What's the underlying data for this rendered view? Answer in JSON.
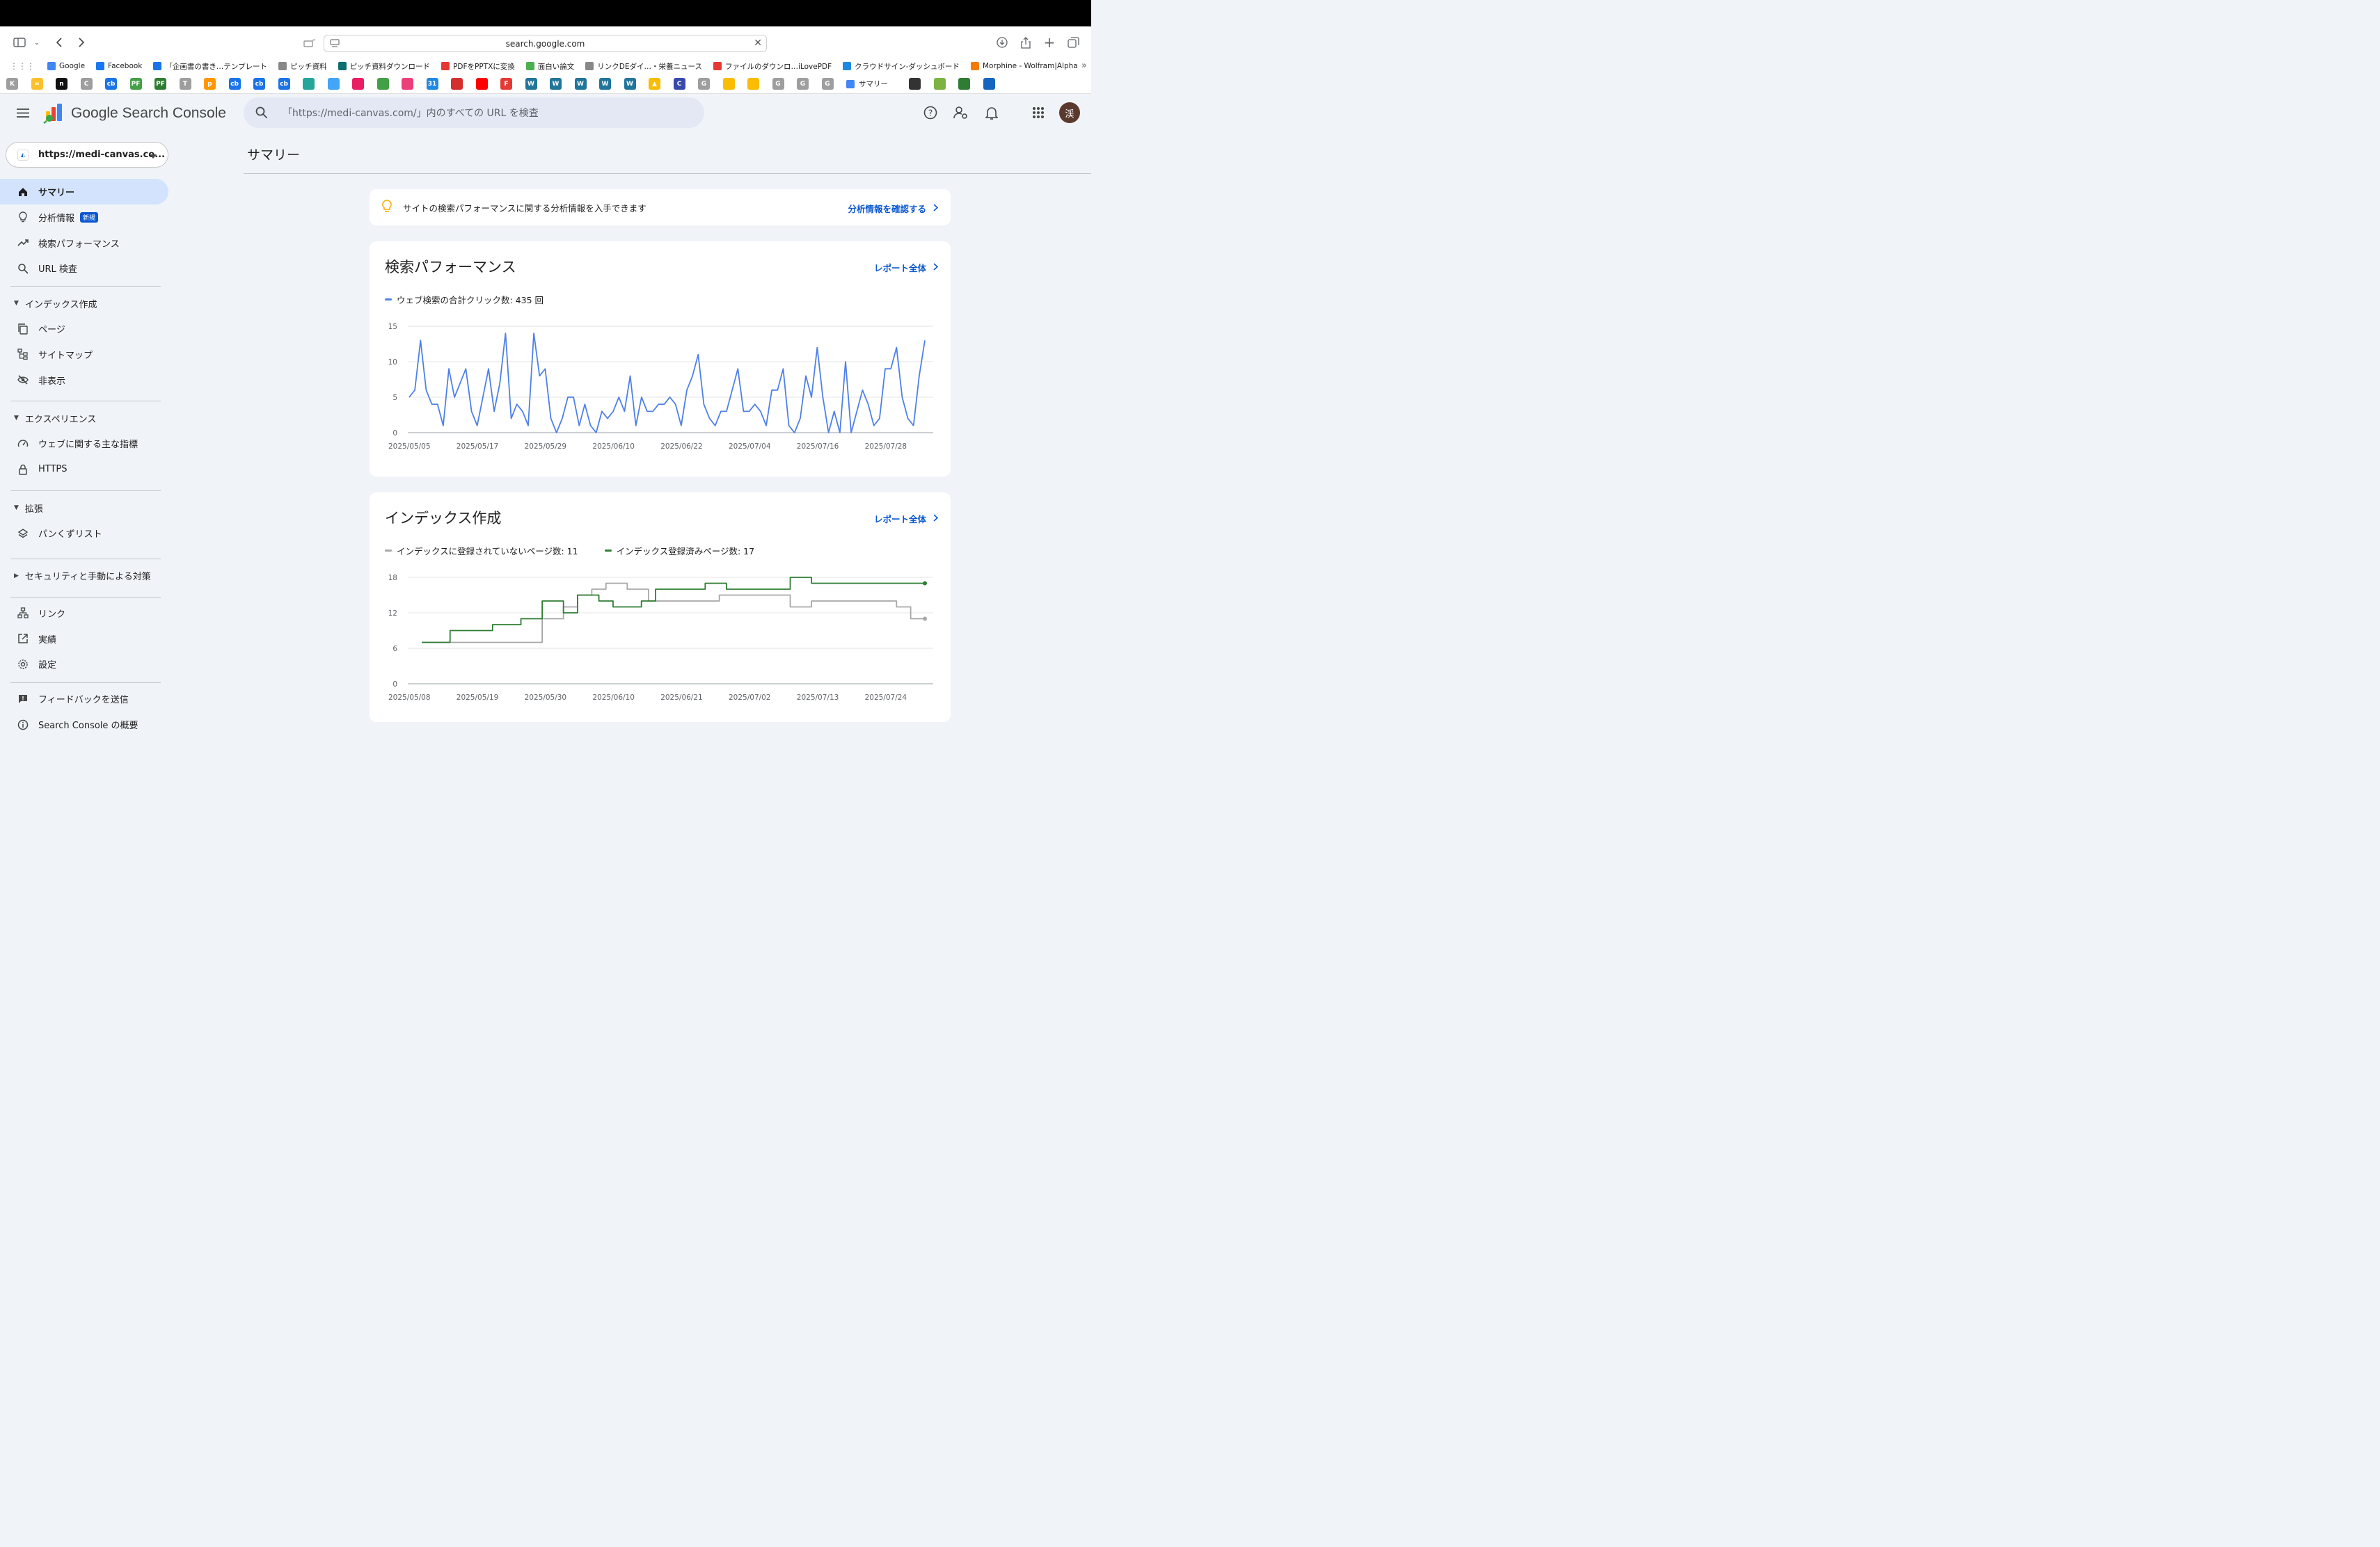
{
  "browser": {
    "url": "search.google.com",
    "bookmarks": [
      {
        "label": "Google",
        "color": "#4285f4"
      },
      {
        "label": "Facebook",
        "color": "#1877f2"
      },
      {
        "label": "「企画書の書き…テンプレート",
        "color": "#1a73e8"
      },
      {
        "label": "ピッチ資料",
        "color": "#888888"
      },
      {
        "label": "ピッチ資料ダウンロード",
        "color": "#0f6e6e"
      },
      {
        "label": "PDFをPPTXに変換",
        "color": "#e53935"
      },
      {
        "label": "面白い論文",
        "color": "#4caf50"
      },
      {
        "label": "リンクDEダイ…・栄養ニュース",
        "color": "#888888"
      },
      {
        "label": "ファイルのダウンロ…iLovePDF",
        "color": "#e53935"
      },
      {
        "label": "クラウドサイン-ダッシュボード",
        "color": "#1e88e5"
      },
      {
        "label": "Morphine - Wolfram|Alpha",
        "color": "#f57c00"
      }
    ],
    "favicons": [
      {
        "text": "K",
        "color": "#9e9e9e"
      },
      {
        "text": "∞",
        "color": "#fbc02d"
      },
      {
        "text": "n",
        "color": "#111111"
      },
      {
        "text": "C",
        "color": "#9e9e9e"
      },
      {
        "text": "cb",
        "color": "#1a73e8"
      },
      {
        "text": "PF",
        "color": "#43a047"
      },
      {
        "text": "PF",
        "color": "#2e7d32"
      },
      {
        "text": "T",
        "color": "#9e9e9e"
      },
      {
        "text": "p",
        "color": "#ff9800"
      },
      {
        "text": "cb",
        "color": "#1a73e8"
      },
      {
        "text": "cb",
        "color": "#1a73e8"
      },
      {
        "text": "cb",
        "color": "#1a73e8"
      },
      {
        "text": "",
        "color": "#26a69a"
      },
      {
        "text": "",
        "color": "#42a5f5"
      },
      {
        "text": "",
        "color": "#e91e63"
      },
      {
        "text": "",
        "color": "#43a047"
      },
      {
        "text": "",
        "color": "#ec407a"
      },
      {
        "text": "31",
        "color": "#1e88e5"
      },
      {
        "text": "",
        "color": "#d32f2f"
      },
      {
        "text": "",
        "color": "#ff0000"
      },
      {
        "text": "F",
        "color": "#e53935"
      },
      {
        "text": "W",
        "color": "#21759b"
      },
      {
        "text": "W",
        "color": "#21759b"
      },
      {
        "text": "W",
        "color": "#21759b"
      },
      {
        "text": "W",
        "color": "#21759b"
      },
      {
        "text": "W",
        "color": "#21759b"
      },
      {
        "text": "▲",
        "color": "#fbbc04"
      },
      {
        "text": "C",
        "color": "#3949ab"
      },
      {
        "text": "G",
        "color": "#9e9e9e"
      },
      {
        "text": "",
        "color": "#fbbc04"
      },
      {
        "text": "",
        "color": "#fbbc04"
      },
      {
        "text": "G",
        "color": "#9e9e9e"
      },
      {
        "text": "G",
        "color": "#9e9e9e"
      },
      {
        "text": "G",
        "color": "#9e9e9e"
      },
      {
        "text": "",
        "color": "#333333"
      },
      {
        "text": "",
        "color": "#7cb342"
      },
      {
        "text": "",
        "color": "#2e7d32"
      },
      {
        "text": "",
        "color": "#1565c0"
      }
    ],
    "active_tab": "サマリー"
  },
  "app": {
    "product_name": "Google Search Console",
    "search_placeholder": "「https://medi-canvas.com/」内のすべての URL を検査",
    "avatar_letter": "渓"
  },
  "sidebar": {
    "property": "https://medi-canvas.co...",
    "items": [
      {
        "label": "サマリー",
        "icon": "home-icon",
        "active": true
      },
      {
        "label": "分析情報",
        "icon": "lightbulb-icon",
        "badge": "新規"
      },
      {
        "label": "検索パフォーマンス",
        "icon": "trending-up-icon"
      },
      {
        "label": "URL 検査",
        "icon": "search-icon"
      }
    ],
    "sections": [
      {
        "title": "インデックス作成",
        "expanded": true,
        "items": [
          {
            "label": "ページ",
            "icon": "pages-icon"
          },
          {
            "label": "サイトマップ",
            "icon": "sitemap-icon"
          },
          {
            "label": "非表示",
            "icon": "visibility-off-icon"
          }
        ]
      },
      {
        "title": "エクスペリエンス",
        "expanded": true,
        "items": [
          {
            "label": "ウェブに関する主な指標",
            "icon": "speed-icon"
          },
          {
            "label": "HTTPS",
            "icon": "lock-icon"
          }
        ]
      },
      {
        "title": "拡張",
        "expanded": true,
        "items": [
          {
            "label": "パンくずリスト",
            "icon": "layers-icon"
          }
        ]
      },
      {
        "title": "セキュリティと手動による対策",
        "expanded": false,
        "items": []
      }
    ],
    "bottom_items": [
      {
        "label": "リンク",
        "icon": "links-icon"
      },
      {
        "label": "実績",
        "icon": "open-in-new-icon"
      },
      {
        "label": "設定",
        "icon": "settings-icon"
      }
    ],
    "footer_items": [
      {
        "label": "フィードバックを送信",
        "icon": "feedback-icon"
      },
      {
        "label": "Search Console の概要",
        "icon": "info-icon"
      }
    ]
  },
  "main": {
    "page_title": "サマリー",
    "insight": {
      "text": "サイトの検索パフォーマンスに関する分析情報を入手できます",
      "link": "分析情報を確認する"
    },
    "performance_card": {
      "title": "検索パフォーマンス",
      "link": "レポート全体"
    },
    "index_card": {
      "title": "インデックス作成",
      "link": "レポート全体"
    }
  },
  "chart_data": [
    {
      "type": "line",
      "title": "検索パフォーマンス",
      "series": [
        {
          "name": "ウェブ検索の合計クリック数: 435 回",
          "color": "#4e80e8",
          "values": [
            5,
            6,
            13,
            6,
            4,
            4,
            1,
            9,
            5,
            7,
            9,
            3,
            1,
            5,
            9,
            3,
            7,
            14,
            2,
            4,
            3,
            1,
            14,
            8,
            9,
            2,
            0,
            2,
            5,
            5,
            1,
            4,
            1,
            0,
            3,
            2,
            3,
            5,
            3,
            8,
            1,
            5,
            3,
            3,
            4,
            4,
            5,
            4,
            1,
            6,
            8,
            11,
            4,
            2,
            1,
            3,
            3,
            6,
            9,
            3,
            3,
            4,
            3,
            1,
            6,
            6,
            9,
            1,
            0,
            2,
            8,
            5,
            12,
            5,
            0,
            3,
            0,
            10,
            0,
            3,
            6,
            4,
            1,
            2,
            9,
            9,
            12,
            5,
            2,
            1,
            8,
            13
          ]
        }
      ],
      "x_tick_labels": [
        "2025/05/05",
        "2025/05/17",
        "2025/05/29",
        "2025/06/10",
        "2025/06/22",
        "2025/07/04",
        "2025/07/16",
        "2025/07/28"
      ],
      "y_ticks": [
        0,
        5,
        10,
        15
      ],
      "ylim": [
        0,
        15
      ],
      "grid": true,
      "legend": "top-left"
    },
    {
      "type": "line",
      "title": "インデックス作成",
      "series": [
        {
          "name": "インデックスに登録されていないページ数: 11",
          "color": "#a8a8a8",
          "values": [
            7,
            7,
            7,
            7,
            7,
            7,
            7,
            7,
            7,
            7,
            7,
            7,
            7,
            7,
            7,
            7,
            7,
            11,
            11,
            11,
            13,
            13,
            15,
            15,
            16,
            16,
            17,
            17,
            17,
            16,
            16,
            16,
            14,
            14,
            14,
            14,
            14,
            14,
            14,
            14,
            14,
            14,
            15,
            15,
            15,
            15,
            15,
            15,
            15,
            15,
            15,
            15,
            13,
            13,
            13,
            14,
            14,
            14,
            14,
            14,
            14,
            14,
            14,
            14,
            14,
            14,
            14,
            13,
            13,
            11,
            11,
            11
          ]
        },
        {
          "name": "インデックス登録済みページ数: 17",
          "color": "#2e7d32",
          "values": [
            7,
            7,
            7,
            7,
            9,
            9,
            9,
            9,
            9,
            9,
            10,
            10,
            10,
            10,
            11,
            11,
            11,
            14,
            14,
            14,
            12,
            12,
            15,
            15,
            15,
            14,
            14,
            13,
            13,
            13,
            13,
            14,
            14,
            16,
            16,
            16,
            16,
            16,
            16,
            16,
            17,
            17,
            17,
            16,
            16,
            16,
            16,
            16,
            16,
            16,
            16,
            16,
            18,
            18,
            18,
            17,
            17,
            17,
            17,
            17,
            17,
            17,
            17,
            17,
            17,
            17,
            17,
            17,
            17,
            17,
            17,
            17
          ]
        }
      ],
      "x_tick_labels": [
        "2025/05/08",
        "2025/05/19",
        "2025/05/30",
        "2025/06/10",
        "2025/06/21",
        "2025/07/02",
        "2025/07/13",
        "2025/07/24"
      ],
      "y_ticks": [
        0,
        6,
        12,
        18
      ],
      "ylim": [
        0,
        18
      ],
      "grid": true,
      "legend": "top-left"
    }
  ]
}
